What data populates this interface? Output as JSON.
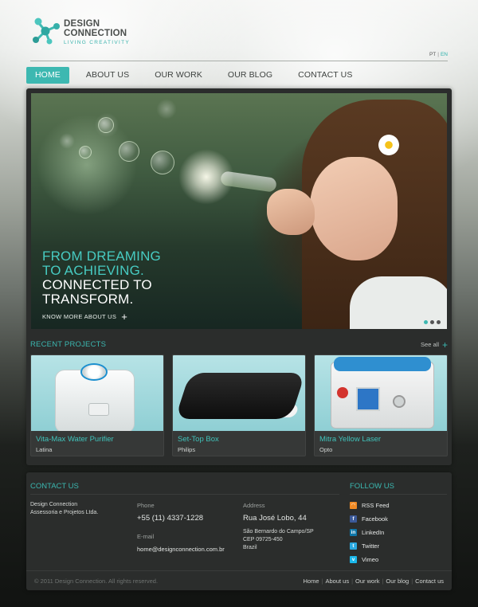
{
  "brand": {
    "title_line1": "DESIGN",
    "title_line2": "CONNECTION",
    "tagline": "LIVING CREATIVITY",
    "accent_color": "#3db8b1"
  },
  "language": {
    "pt": "PT",
    "separator": "|",
    "en": "EN",
    "active": "EN"
  },
  "nav": {
    "items": [
      {
        "label": "HOME",
        "active": true
      },
      {
        "label": "ABOUT US",
        "active": false
      },
      {
        "label": "OUR WORK",
        "active": false
      },
      {
        "label": "OUR BLOG",
        "active": false
      },
      {
        "label": "CONTACT US",
        "active": false
      }
    ]
  },
  "hero": {
    "line1": "FROM DREAMING",
    "line2": "TO ACHIEVING.",
    "line3": "CONNECTED TO",
    "line4": "TRANSFORM.",
    "link_label": "KNOW MORE ABOUT US",
    "link_icon": "plus-icon",
    "slides_total": 3,
    "slide_active": 1
  },
  "recent_projects": {
    "title": "RECENT PROJECTS",
    "see_all": "See all",
    "items": [
      {
        "name": "Vita-Max Water Purifier",
        "client": "Latina"
      },
      {
        "name": "Set-Top Box",
        "client": "Philips"
      },
      {
        "name": "Mitra Yellow Laser",
        "client": "Opto"
      }
    ]
  },
  "footer": {
    "contact_title": "CONTACT US",
    "company_line1": "Design Connection",
    "company_line2": "Assessoria e Projetos Ltda.",
    "phone_label": "Phone",
    "phone": "+55 (11) 4337-1228",
    "email_label": "E-mail",
    "email": "home@designconnection.com.br",
    "address_label": "Address",
    "address_street": "Rua José Lobo, 44",
    "address_city": "São Bernardo do Campo/SP",
    "address_zip": "CEP 09725-450",
    "address_country": "Brazil",
    "follow_title": "FOLLOW US",
    "social": [
      {
        "label": "RSS Feed",
        "icon": "rss-icon",
        "color": "#f08a24"
      },
      {
        "label": "Facebook",
        "icon": "facebook-icon",
        "color": "#3b5998"
      },
      {
        "label": "LinkedIn",
        "icon": "linkedin-icon",
        "color": "#0e76a8"
      },
      {
        "label": "Twitter",
        "icon": "twitter-icon",
        "color": "#2aa9e0"
      },
      {
        "label": "Vimeo",
        "icon": "vimeo-icon",
        "color": "#1ab7ea"
      }
    ],
    "copyright": "© 2011 Design Connection. All rights reserved.",
    "links": [
      "Home",
      "About us",
      "Our work",
      "Our blog",
      "Contact us"
    ]
  }
}
